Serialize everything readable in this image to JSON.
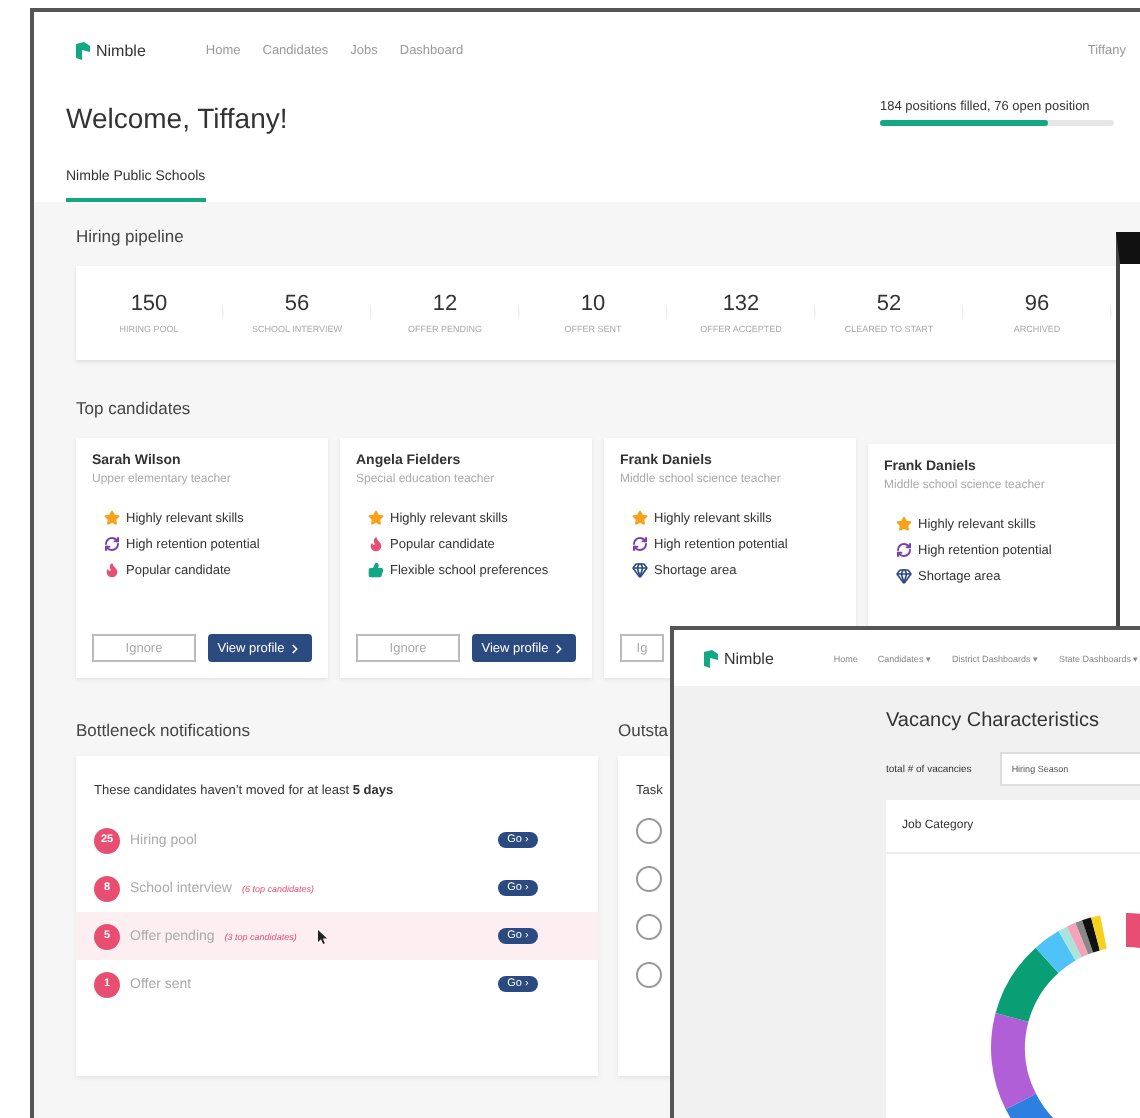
{
  "main_window": {
    "brand": "Nimble",
    "nav": [
      {
        "label": "Home"
      },
      {
        "label": "Candidates"
      },
      {
        "label": "Jobs"
      },
      {
        "label": "Dashboard"
      }
    ],
    "user": "Tiffany",
    "welcome": "Welcome, Tiffany!",
    "progress": {
      "text": "184 positions filled, 76 open position",
      "level": 0.72
    },
    "tabs": [
      {
        "label": "Nimble Public Schools",
        "selected": true
      }
    ],
    "pipeline": {
      "title": "Hiring pipeline",
      "stages": [
        {
          "count": "150",
          "label": "HIRING POOL"
        },
        {
          "count": "56",
          "label": "SCHOOL INTERVIEW"
        },
        {
          "count": "12",
          "label": "OFFER PENDING"
        },
        {
          "count": "10",
          "label": "OFFER SENT"
        },
        {
          "count": "132",
          "label": "OFFER ACCEPTED"
        },
        {
          "count": "52",
          "label": "CLEARED TO START"
        },
        {
          "count": "96",
          "label": "ARCHIVED"
        }
      ]
    },
    "top_candidates": {
      "title": "Top candidates",
      "cards": [
        {
          "name": "Sarah Wilson",
          "role": "Upper elementary teacher",
          "traits": [
            {
              "kind": "skills",
              "text": "Highly relevant skills"
            },
            {
              "kind": "retention",
              "text": "High retention potential"
            },
            {
              "kind": "popular",
              "text": "Popular candidate"
            }
          ],
          "ignore": "Ignore",
          "view": "View profile"
        },
        {
          "name": "Angela Fielders",
          "role": "Special education teacher",
          "traits": [
            {
              "kind": "skills",
              "text": "Highly relevant skills"
            },
            {
              "kind": "popular",
              "text": "Popular candidate"
            },
            {
              "kind": "flexible",
              "text": "Flexible school preferences"
            }
          ],
          "ignore": "Ignore",
          "view": "View profile"
        },
        {
          "name": "Frank Daniels",
          "role": "Middle school science teacher",
          "traits": [
            {
              "kind": "skills",
              "text": "Highly relevant skills"
            },
            {
              "kind": "retention",
              "text": "High retention potential"
            },
            {
              "kind": "shortage",
              "text": "Shortage area"
            }
          ],
          "ignore": "Ig"
        },
        {
          "name": "Frank Daniels",
          "role": "Middle school science teacher",
          "traits": [
            {
              "kind": "skills",
              "text": "Highly relevant skills"
            },
            {
              "kind": "retention",
              "text": "High retention potential"
            },
            {
              "kind": "shortage",
              "text": "Shortage area"
            }
          ]
        }
      ]
    },
    "bottleneck": {
      "title": "Bottleneck notifications",
      "intro": "These candidates haven’t moved for at least **5 days**",
      "rows": [
        {
          "count": "25",
          "label": "Hiring pool",
          "highlighted": false,
          "go": "Go ›"
        },
        {
          "count": "8",
          "label": "School interview",
          "note": "(6 top candidates)",
          "highlighted": false,
          "go": "Go ›"
        },
        {
          "count": "5",
          "label": "Offer pending",
          "note": "(3 top candidates)",
          "highlighted": true,
          "go": "Go ›"
        },
        {
          "count": "1",
          "label": "Offer sent",
          "highlighted": false,
          "go": "Go ›"
        }
      ]
    },
    "outstanding": {
      "title": "Outsta",
      "subtitle": "Task",
      "tasks": [
        {
          "checked": false
        },
        {
          "checked": false
        },
        {
          "checked": false
        },
        {
          "checked": false
        }
      ]
    }
  },
  "dashboard_window": {
    "brand": "Nimble",
    "nav": [
      {
        "label": "Home"
      },
      {
        "label": "Candidates ▾"
      },
      {
        "label": "District Dashboards ▾"
      },
      {
        "label": "State Dashboards ▾"
      }
    ],
    "title": "Vacancy Characteristics",
    "filter_label": "total # of vacancies",
    "filter_value": "Hiring Season",
    "card_title": "Job Category"
  }
}
